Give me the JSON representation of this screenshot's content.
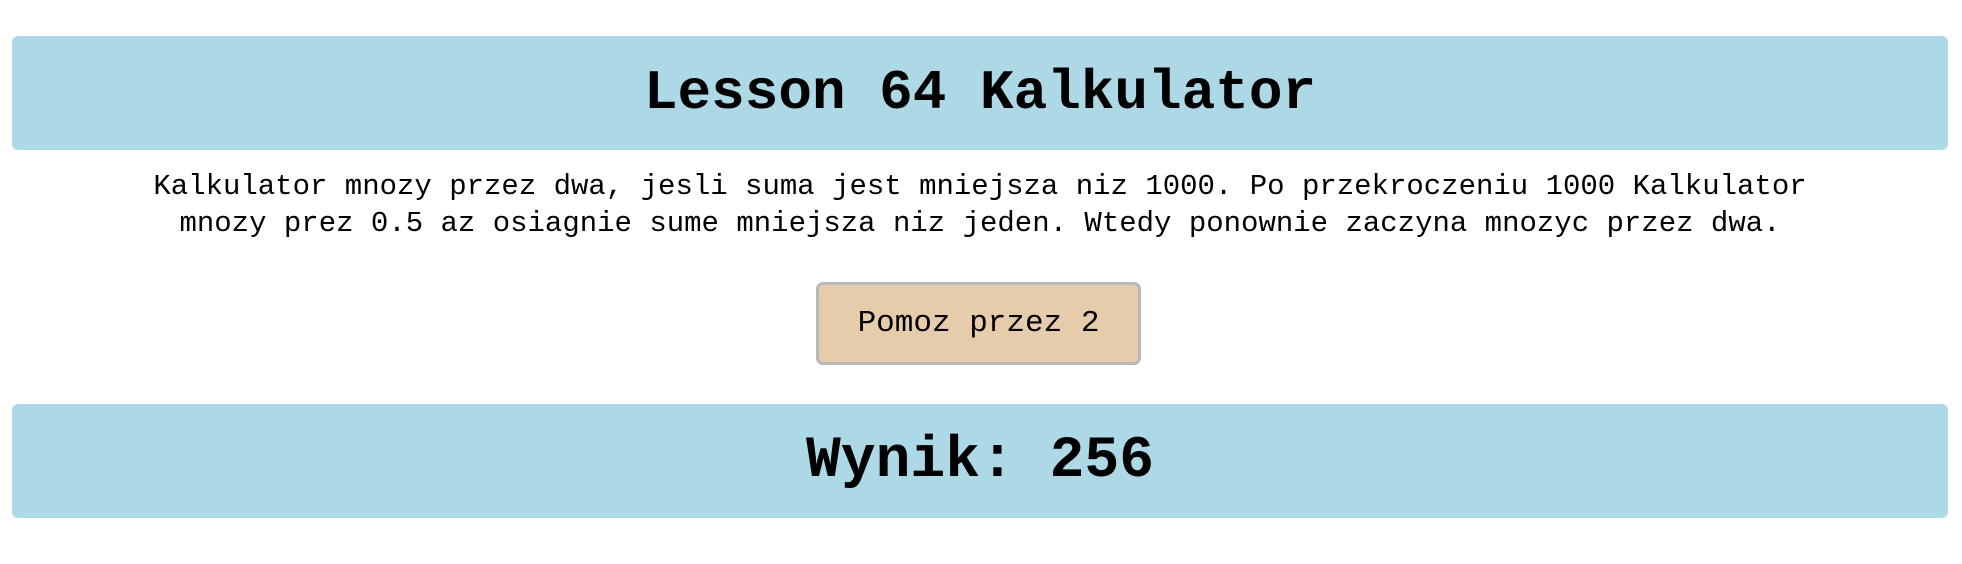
{
  "header": {
    "title": "Lesson 64 Kalkulator"
  },
  "description": {
    "line1": "Kalkulator mnozy przez dwa, jesli suma jest mniejsza niz 1000. Po przekroczeniu 1000 Kalkulator",
    "line2": "mnozy prez 0.5 az osiagnie sume mniejsza niz jeden. Wtedy ponownie zaczyna mnozyc przez dwa."
  },
  "action": {
    "button_label": "Pomoz przez 2"
  },
  "result": {
    "text": "Wynik: 256"
  },
  "colors": {
    "panel_background": "#add8e6",
    "button_background": "#e6ccab",
    "button_border": "#b8b8b8"
  }
}
